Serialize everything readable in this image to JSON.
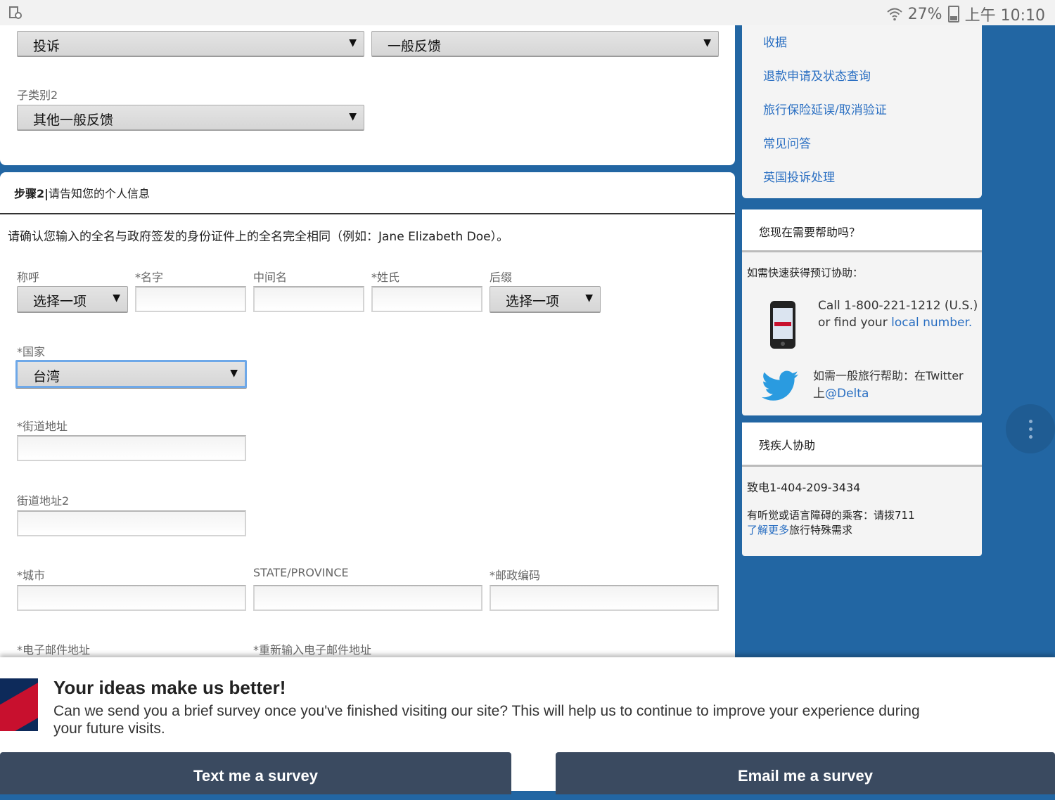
{
  "status_bar": {
    "battery": "27%",
    "time": "上午 10:10"
  },
  "form_top": {
    "category_value": "投诉",
    "subcategory_value": "一般反馈",
    "subcategory2_label": "子类别2",
    "subcategory2_value": "其他一般反馈"
  },
  "step2": {
    "header_step": "步骤2",
    "header_sep": "|",
    "header_text": "请告知您的个人信息",
    "instruction": "请确认您输入的全名与政府签发的身份证件上的全名完全相同（例如：Jane Elizabeth Doe）。",
    "labels": {
      "prefix": "称呼",
      "first": "*名字",
      "middle": "中间名",
      "last": "*姓氏",
      "suffix": "后缀",
      "country": "*国家",
      "street": "*街道地址",
      "street2": "街道地址2",
      "city": "*城市",
      "state": "STATE/PROVINCE",
      "zip": "*邮政编码",
      "email": "*电子邮件地址",
      "email_confirm": "*重新输入电子邮件地址"
    },
    "prefix_value": "选择一项",
    "suffix_value": "选择一项",
    "country_value": "台湾"
  },
  "sidebar": {
    "links": [
      "收据",
      "退款申请及状态查询",
      "旅行保险延误/取消验证",
      "常见问答",
      "英国投诉处理"
    ],
    "help": {
      "title": "您现在需要帮助吗？",
      "quick": "如需快速获得预订协助：",
      "call": "Call 1-800-221-1212 (U.S.)",
      "find_prefix": "or find your ",
      "find_link": "local number.",
      "twitter_text": "如需一般旅行帮助：在Twitter",
      "twitter_prefix": "上",
      "twitter_handle": "@Delta"
    },
    "disability": {
      "title": "残疾人协助",
      "phone": "致电1-404-209-3434",
      "hearing": "有听觉或语言障碍的乘客：请拨711",
      "learn_link": "了解更多",
      "learn_suffix": "旅行特殊需求"
    }
  },
  "survey": {
    "title": "Your ideas make us better!",
    "text": "Can we send you a brief survey once you've finished visiting our site? This will help us to continue to improve your experience during your future visits.",
    "text_button": "Text me a survey",
    "email_button": "Email me a survey"
  },
  "colors": {
    "brand_blue": "#2266a3",
    "link": "#2a6fc2",
    "button": "#3a4a60",
    "delta_red": "#c8102e"
  }
}
